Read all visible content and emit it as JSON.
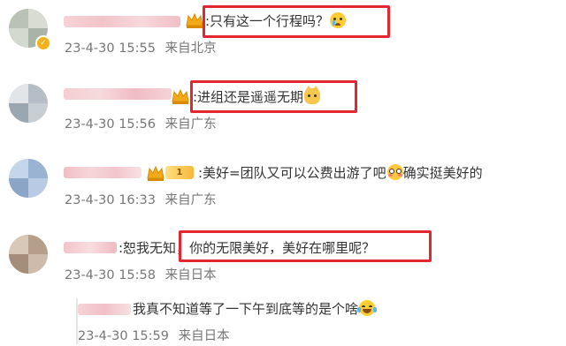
{
  "comments": [
    {
      "text": ":只有这一个行程吗？",
      "emoji": "crying-face-emoji",
      "date": "23-4-30 15:55",
      "location": "来自北京"
    },
    {
      "text": ":进组还是遥遥无期",
      "emoji": "cat-face-emoji",
      "date": "23-4-30 15:56",
      "location": "来自广东"
    },
    {
      "text": ":美好=团队又可以公费出游了吧",
      "text_after_emoji": "确实挺美好的",
      "emoji": "flushed-face-emoji",
      "level": "1",
      "date": "23-4-30 16:33",
      "location": "来自广东"
    },
    {
      "text_prefix": ":恕我无知",
      "text": "，你的无限美好，美好在哪里呢？",
      "date": "23-4-30 15:58",
      "location": "来自日本"
    }
  ],
  "reply": {
    "text": "我真不知道等了一下午到底等的是个啥",
    "emoji": "crying-laughing-emoji",
    "date": "23-4-30 15:59",
    "location": "来自日本"
  },
  "colors": {
    "highlight": "#e3262f",
    "meta_text": "#777777",
    "body_text": "#333333",
    "blurred_name": "#f4c7cc"
  }
}
